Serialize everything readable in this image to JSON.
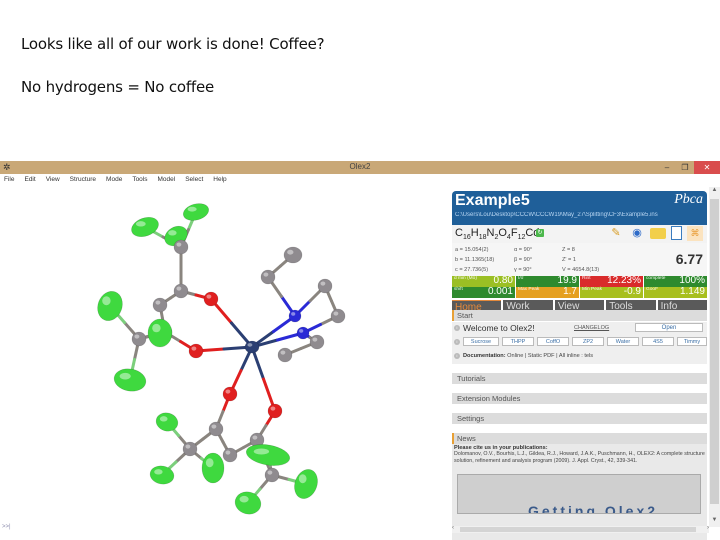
{
  "slide": {
    "caption_line1": "Looks like all of our work is done! Coffee?",
    "caption_line2": "No hydrogens = No coffee"
  },
  "window": {
    "title": "Olex2",
    "app_icon": "olex2-app-icon",
    "controls": {
      "minimize": "–",
      "maximize": "❐",
      "close": "✕"
    },
    "menu": [
      "File",
      "Edit",
      "View",
      "Structure",
      "Mode",
      "Tools",
      "Model",
      "Select",
      "Help"
    ]
  },
  "viewport": {
    "command_prompt": ">>|",
    "atom_colors": {
      "fluorine": "#3fd93f",
      "carbon": "#8f8b8f",
      "oxygen": "#e01f1f",
      "nitrogen": "#2a2ad6",
      "cadmium": "#2b3f73"
    }
  },
  "panel": {
    "structure_name": "Example5",
    "space_group": "Pbca",
    "file_path": "C:\\Users\\Lou\\Desktop\\CCCW\\CCCW19\\May_27\\Splitting\\CF3\\Example5.ins",
    "formula": {
      "parts": [
        [
          "C",
          "16"
        ],
        [
          "H",
          "18"
        ],
        [
          "N",
          "2"
        ],
        [
          "O",
          "4"
        ],
        [
          "F",
          "12"
        ],
        [
          "Cd",
          ""
        ]
      ]
    },
    "toolbar_icons": [
      "pencil-icon",
      "globe-icon",
      "folder-icon",
      "document-icon",
      "structure-icon"
    ],
    "cell": {
      "col1": [
        "a = 15.054(2)",
        "b = 11.1365(18)",
        "c = 27.736(5)"
      ],
      "col2": [
        "α = 90°",
        "β = 90°",
        "γ = 90°"
      ],
      "col3": [
        "Z = 8",
        "Z' = 1",
        "V = 4654.8(13)"
      ]
    },
    "r_factor": "6.77",
    "stats": [
      {
        "label": "d min (Mo)",
        "value": "0.80",
        "color": "#9bbf24"
      },
      {
        "label": "I/σ",
        "value": "19.9",
        "color": "#2e8a2e"
      },
      {
        "label": "Rint",
        "value": "12.23%",
        "color": "#d92b2b"
      },
      {
        "label": "complete",
        "value": "100%",
        "color": "#2e8a2e"
      },
      {
        "label": "shift",
        "value": "0.001",
        "color": "#2e8a2e"
      },
      {
        "label": "Max Peak",
        "value": "1.7",
        "color": "#e5a021"
      },
      {
        "label": "Min Peak",
        "value": "-0.9",
        "color": "#a8bf1f"
      },
      {
        "label": "GooF",
        "value": "1.149",
        "color": "#a8bf1f"
      }
    ],
    "tabs": [
      {
        "label": "Home",
        "active": true
      },
      {
        "label": "Work",
        "active": false
      },
      {
        "label": "View",
        "active": false
      },
      {
        "label": "Tools",
        "active": false
      },
      {
        "label": "Info",
        "active": false
      }
    ],
    "start": {
      "title": "Start",
      "welcome": "Welcome to Olex2!",
      "changelog": "CHANGELOG",
      "open_label": "Open",
      "samples": [
        "Sucrose",
        "THPP",
        "CoffO",
        "ZP2",
        "Water",
        "4S5",
        "Timmy"
      ],
      "docs_label": "Documentation:",
      "docs_links": "Online | Static PDF | All inline : tels"
    },
    "sections": [
      "Tutorials",
      "Extension Modules",
      "Settings"
    ],
    "news": {
      "title": "News",
      "heading": "Please cite us in your publications:",
      "citation": "Dolomanov, O.V., Bourhis, L.J., Gildea, R.J., Howard, J.A.K., Puschmann, H., OLEX2: A complete structure solution, refinement and analysis program (2009). J. Appl. Cryst., 42, 339-341.",
      "image_text": "Getting Olex2"
    }
  }
}
